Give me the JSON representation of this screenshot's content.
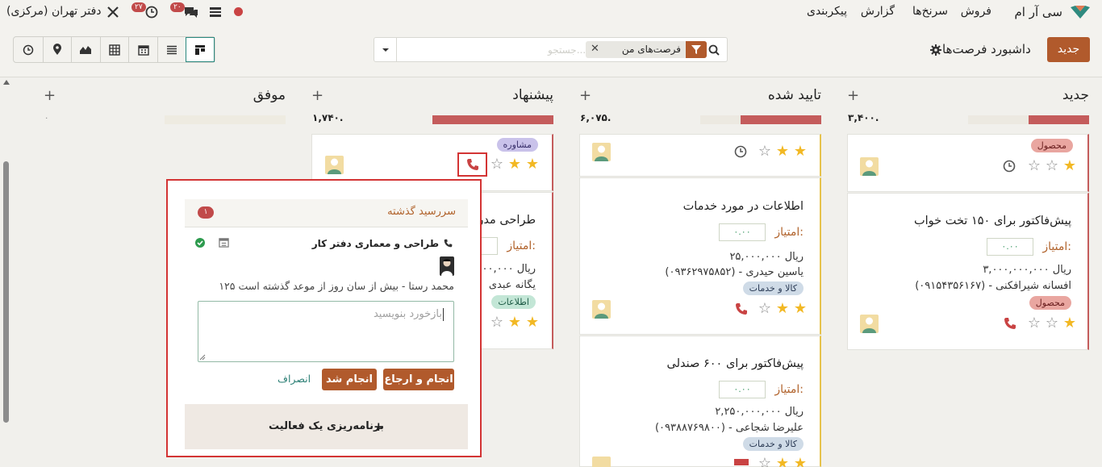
{
  "navbar": {
    "app_name": "سی آر ام",
    "menu": [
      "فروش",
      "سرنخ‌ها",
      "گزارش",
      "پیکربندی"
    ],
    "company": "دفتر تهران (مرکزی)",
    "messages_count": "۲۰",
    "activities_count": "۲۷"
  },
  "controls": {
    "new_button": "جدید",
    "breadcrumb": "داشبورد فرصت‌ها",
    "filter_facet": "فرصت‌های من",
    "search_placeholder": "جستجو..."
  },
  "columns": [
    {
      "title": "جدید",
      "sum": "۳,۴۰۰."
    },
    {
      "title": "تایید شده",
      "sum": "۶,۰۷۵."
    },
    {
      "title": "پیشنهاد",
      "sum": "۱,۷۴۰."
    },
    {
      "title": "موفق",
      "sum": "۰"
    }
  ],
  "cards": {
    "new_top": {
      "tag": "محصول"
    },
    "new_2": {
      "title": "پیش‌فاکتور برای ۱۵۰ تخت خواب",
      "score_label": "امتیاز:",
      "score": "۰.۰۰",
      "revenue": "ریال ۳,۰۰۰,۰۰۰,۰۰۰",
      "contact": "افسانه شیرافکنی - (۰۹۱۵۴۳۵۶۱۶۷)",
      "tag": "محصول"
    },
    "conf_2": {
      "title": "اطلاعات در مورد خدمات",
      "score_label": "امتیاز:",
      "score": "۰.۰۰",
      "revenue": "ریال ۲۵,۰۰۰,۰۰۰",
      "contact": "یاسین حیدری - (۰۹۳۶۲۹۷۵۸۵۲)",
      "tag": "کالا و خدمات"
    },
    "conf_3": {
      "title": "پیش‌فاکتور برای ۶۰۰ صندلی",
      "score_label": "امتیاز:",
      "score": "۰.۰۰",
      "revenue": "ریال ۲,۲۵۰,۰۰۰,۰۰۰",
      "contact": "علیرضا شجاعی - (۰۹۳۸۸۷۶۹۸۰۰)",
      "tag": "کالا و خدمات"
    },
    "prop_1": {
      "tag": "مشاوره"
    },
    "prop_2": {
      "title": "طراحی مدر",
      "score_label": "امتیاز:",
      "revenue": "ریال ۰۰۰,۰۰۰",
      "contact": "یگانه عبدی",
      "tag": "اطلاعات"
    }
  },
  "popover": {
    "header": "سررسید گذشته",
    "count": "۱",
    "activity_title": "طراحی و معماری دفتر کار",
    "activity_meta": "محمد رستا - بیش از سان روز از موعد گذشته است ۱۲۵",
    "feedback_placeholder": "بازخورد بنویسید",
    "done_and_schedule": "انجام و ارجاع",
    "done": "انجام شد",
    "discard": "انصراف",
    "schedule_activity": "برنامه‌ریزی یک فعالیت"
  },
  "colors": {
    "accent": "#b15a2c",
    "danger": "#d33434",
    "teal": "#2b8a80"
  }
}
